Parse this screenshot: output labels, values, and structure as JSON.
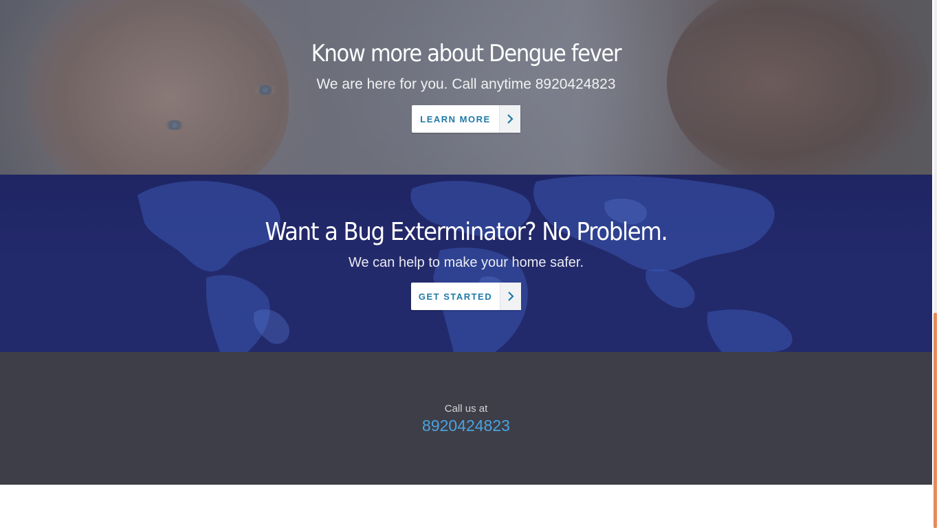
{
  "hero_dengue": {
    "title": "Know more about Dengue fever",
    "subtitle": "We are here for you. Call anytime 8920424823",
    "button_label": "LEARN MORE",
    "button_icon": "chevron-right-icon",
    "background_image": "men-faces-photo"
  },
  "hero_exterminator": {
    "title": "Want a Bug Exterminator? No Problem.",
    "subtitle": "We can help to make your home safer.",
    "button_label": "GET STARTED",
    "button_icon": "chevron-right-icon",
    "background_image": "world-map-graphic"
  },
  "footer": {
    "call_label": "Call us at",
    "phone": "8920424823"
  },
  "colors": {
    "accent_link": "#4aa3df",
    "button_text": "#1f78a8",
    "navy_band": "#232a6c",
    "footer_bg": "#3e3e48",
    "scrollbar_thumb": "#e7895c"
  },
  "scroll": {
    "position_fraction": 0.99
  }
}
